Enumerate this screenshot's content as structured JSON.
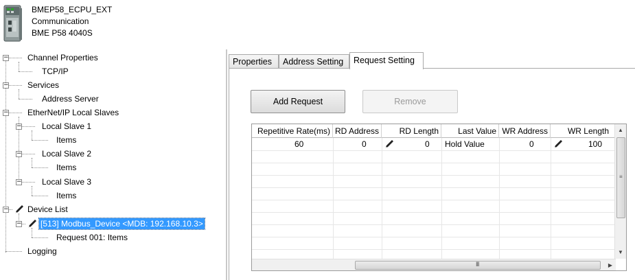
{
  "module": {
    "name": "BMEP58_ECPU_EXT",
    "category": "Communication",
    "part_number": "BME P58 4040S"
  },
  "tree": {
    "channel_properties": "Channel Properties",
    "tcpip": "TCP/IP",
    "services": "Services",
    "address_server": "Address Server",
    "ethernetip_local_slaves": "EtherNet/IP Local Slaves",
    "local_slave_1": "Local Slave 1",
    "local_slave_1_items": "Items",
    "local_slave_2": "Local Slave 2",
    "local_slave_2_items": "Items",
    "local_slave_3": "Local Slave 3",
    "local_slave_3_items": "Items",
    "device_list": "Device List",
    "modbus_device": "[513] Modbus_Device <MDB: 192.168.10.3>",
    "request_001": "Request 001: Items",
    "logging": "Logging"
  },
  "tabs": {
    "properties": "Properties",
    "address_setting": "Address Setting",
    "request_setting": "Request Setting",
    "active": "request_setting"
  },
  "buttons": {
    "add_request": "Add Request",
    "remove": "Remove"
  },
  "grid": {
    "columns": [
      "Repetitive Rate(ms)",
      "RD Address",
      "RD Length",
      "Last Value",
      "WR Address",
      "WR Length"
    ],
    "rows": [
      {
        "repetitive_rate": "60",
        "rd_address": "0",
        "rd_length": "0",
        "last_value": "Hold Value",
        "wr_address": "0",
        "wr_length": "100"
      }
    ],
    "hscroll_grip": "III",
    "vscroll_grip": "≡"
  },
  "icons": {
    "module": "plc-module-icon",
    "pencil": "pencil-icon",
    "expander_collapse": "⊟"
  },
  "colors": {
    "selection": "#3399ff",
    "tree_lines": "#8a8a8a"
  }
}
